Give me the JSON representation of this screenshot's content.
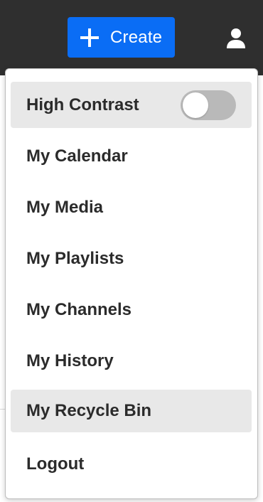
{
  "header": {
    "create_label": "Create",
    "create_icon": "plus-icon",
    "user_icon": "user-icon",
    "create_color": "#0a6df5",
    "bar_color": "#2f2f2f"
  },
  "menu": {
    "high_contrast": {
      "label": "High Contrast",
      "enabled": false
    },
    "items": [
      {
        "label": "My Calendar"
      },
      {
        "label": "My Media"
      },
      {
        "label": "My Playlists"
      },
      {
        "label": "My Channels"
      },
      {
        "label": "My History"
      },
      {
        "label": "My Recycle Bin"
      },
      {
        "label": "Logout"
      }
    ]
  }
}
